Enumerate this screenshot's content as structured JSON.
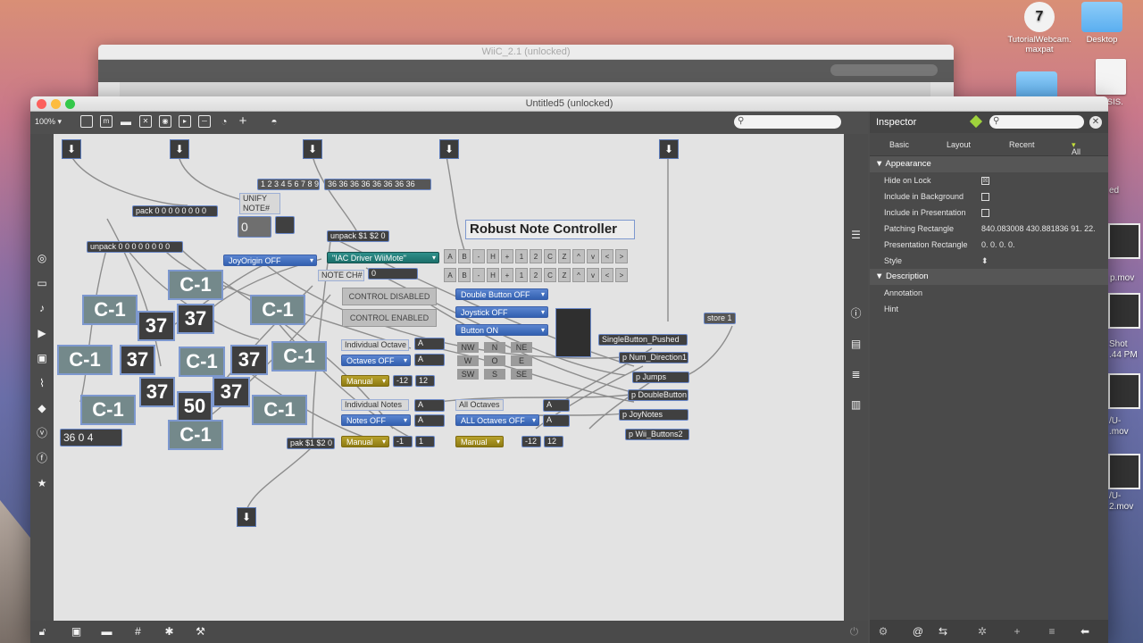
{
  "desktop": {
    "icons": [
      {
        "label": "TutorialWebcam.\nmaxpat",
        "kind": "file"
      },
      {
        "label": "Desktop",
        "kind": "folder"
      },
      {
        "label": "DISIS.",
        "kind": "file"
      }
    ],
    "side_labels": [
      "ed",
      "p.mov",
      "Shot",
      ".44 PM",
      "/U-",
      ".mov",
      "/U-",
      "2.mov"
    ]
  },
  "back_window": {
    "title": "WiiC_2.1 (unlocked)"
  },
  "window": {
    "title": "Untitled5 (unlocked)",
    "zoom": "100%",
    "toolbar_icons": [
      "presentation-icon",
      "patcher-icon",
      "comment-icon",
      "close-box-icon",
      "toggle-icon",
      "outlet-icon",
      "slider-icon",
      "dial-icon",
      "add-icon",
      "paint-bucket-icon"
    ]
  },
  "patch": {
    "title_comment": "Robust Note Controller",
    "objects": {
      "pack": "pack 0 0 0 0 0 0 0 0",
      "unpack": "unpack 0 0 0 0 0 0 0 0",
      "seq_msg": "1 2 3 4 5 6 7 8 9",
      "notes_msg": "36 36 36 36 36 36 36 36",
      "unify_note": "UNIFY NOTE#",
      "unpack_s1s2": "unpack $1 $2 0",
      "joyorigin": "JoyOrigin OFF",
      "iac_driver": "\"IAC Driver WiiMote\"",
      "note_ch": "NOTE CH#",
      "control_disabled": "CONTROL DISABLED",
      "control_enabled": "CONTROL ENABLED",
      "indiv_octave": "Individual Octave",
      "octaves_off": "Octaves OFF",
      "manual_1": "Manual",
      "indiv_notes": "Individual Notes",
      "notes_off": "Notes OFF",
      "manual_2": "Manual",
      "all_octaves": "All Octaves",
      "all_octaves_off": "ALL Octaves OFF",
      "manual_3": "Manual",
      "double_button": "Double Button OFF",
      "joystick": "Joystick OFF",
      "button_on": "Button ON",
      "single_button": "SingleButton_Pushed",
      "num_direction": "p Num_Direction1",
      "jumps": "p Jumps",
      "double_button_p": "p DoubleButton",
      "joynotes": "p JoyNotes",
      "wii_buttons": "p Wii_Buttons2",
      "store": "store 1",
      "pak": "pak $1 $2 0",
      "three_six": "36 0 4",
      "minus12": "-12",
      "twelve": "12",
      "minus1": "-1",
      "one": "1",
      "zero": "0",
      "zero_b": "0"
    },
    "keyrow": [
      "A",
      "B",
      "-",
      "H",
      "+",
      "1",
      "2",
      "C",
      "Z",
      "^",
      "v",
      "<",
      ">"
    ],
    "directions": [
      "NW",
      "N",
      "NE",
      "W",
      "O",
      "E",
      "SW",
      "S",
      "SE"
    ],
    "numboxes": [
      "C-1",
      "C-1",
      "37",
      "37",
      "C-1",
      "C-1",
      "37",
      "C-1",
      "37",
      "C-1",
      "37",
      "50",
      "37",
      "C-1",
      "C-1",
      "C-1"
    ]
  },
  "inspector": {
    "title": "Inspector",
    "tabs": [
      "Basic",
      "Layout",
      "Recent",
      "All"
    ],
    "active_tab": "All",
    "sections": [
      {
        "name": "Appearance",
        "props": [
          {
            "key": "Hide on Lock",
            "type": "check",
            "value": "☒"
          },
          {
            "key": "Include in Background",
            "type": "check",
            "value": ""
          },
          {
            "key": "Include in Presentation",
            "type": "check",
            "value": ""
          },
          {
            "key": "Patching Rectangle",
            "type": "text",
            "value": "840.083008 430.881836 91. 22."
          },
          {
            "key": "Presentation Rectangle",
            "type": "text",
            "value": "0. 0. 0. 0."
          },
          {
            "key": "Style",
            "type": "stepper",
            "value": "⬍"
          }
        ]
      },
      {
        "name": "Description",
        "props": [
          {
            "key": "Annotation",
            "type": "text",
            "value": ""
          },
          {
            "key": "Hint",
            "type": "text",
            "value": ""
          }
        ]
      }
    ]
  },
  "colors": {
    "accent_blue": "#3260b0",
    "accent_green": "#9fd23c",
    "canvas": "#e3e3e3"
  }
}
